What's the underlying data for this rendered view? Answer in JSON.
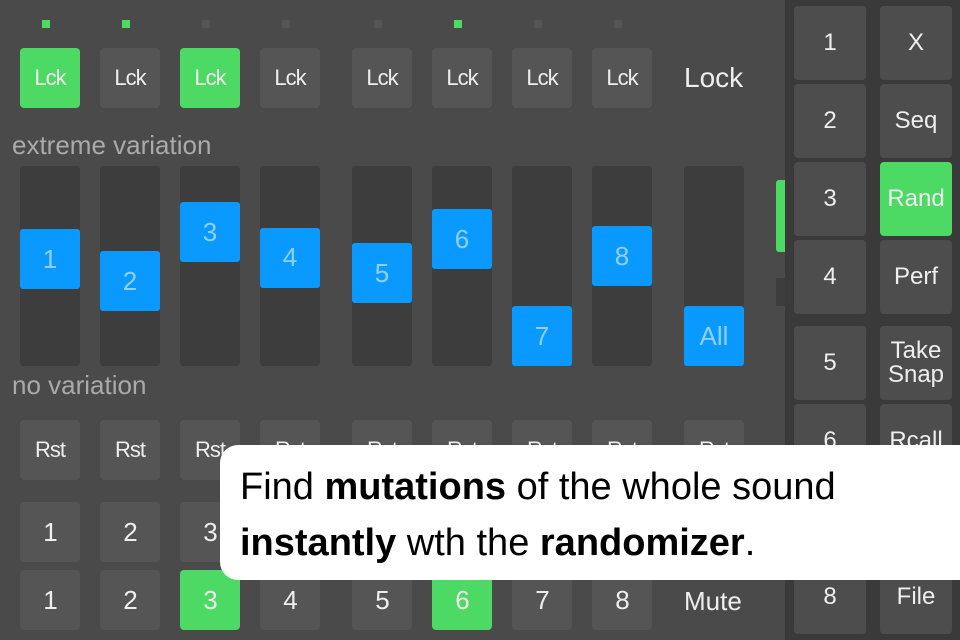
{
  "colors": {
    "accent_green": "#4cd964",
    "slider_blue": "#0a99ff",
    "background": "#4a4a4a"
  },
  "leds": [
    true,
    true,
    false,
    false,
    false,
    true,
    false,
    false
  ],
  "lock_buttons": [
    {
      "label": "Lck",
      "on": true
    },
    {
      "label": "Lck",
      "on": false
    },
    {
      "label": "Lck",
      "on": true
    },
    {
      "label": "Lck",
      "on": false
    },
    {
      "label": "Lck",
      "on": false
    },
    {
      "label": "Lck",
      "on": false
    },
    {
      "label": "Lck",
      "on": false
    },
    {
      "label": "Lck",
      "on": false
    }
  ],
  "lock_label": "Lock",
  "top_label": "extreme variation",
  "bottom_label": "no variation",
  "sliders": [
    {
      "label": "1",
      "value": 0.55
    },
    {
      "label": "2",
      "value": 0.39
    },
    {
      "label": "3",
      "value": 0.74
    },
    {
      "label": "4",
      "value": 0.56
    },
    {
      "label": "5",
      "value": 0.45
    },
    {
      "label": "6",
      "value": 0.69
    },
    {
      "label": "7",
      "value": 0.0
    },
    {
      "label": "8",
      "value": 0.57
    },
    {
      "label": "All",
      "value": 0.0
    }
  ],
  "reset_buttons": [
    "Rst",
    "Rst",
    "Rst",
    "Rst",
    "Rst",
    "Rst",
    "Rst",
    "Rst",
    "Rst"
  ],
  "number_row": [
    "1",
    "2",
    "3"
  ],
  "mute_row": [
    {
      "label": "1",
      "on": false
    },
    {
      "label": "2",
      "on": false
    },
    {
      "label": "3",
      "on": true
    },
    {
      "label": "4",
      "on": false
    },
    {
      "label": "5",
      "on": false
    },
    {
      "label": "6",
      "on": true
    },
    {
      "label": "7",
      "on": false
    },
    {
      "label": "8",
      "on": false
    }
  ],
  "mute_label": "Mute",
  "side_numbers": [
    "1",
    "2",
    "3",
    "4",
    "5",
    "6",
    "8"
  ],
  "side_actions": [
    {
      "label": "X",
      "on": false
    },
    {
      "label": "Seq",
      "on": false
    },
    {
      "label": "Rand",
      "on": true
    },
    {
      "label": "Perf",
      "on": false
    },
    {
      "label": "Take Snap",
      "on": false
    },
    {
      "label": "Rcall",
      "on": false
    },
    {
      "label": "File",
      "on": false
    }
  ],
  "callout": {
    "t1": "Find ",
    "b1": "mutations",
    "t2": " of the whole sound",
    "b2": "instantly",
    "t3": " wth the ",
    "b3": "randomizer",
    "t4": "."
  }
}
